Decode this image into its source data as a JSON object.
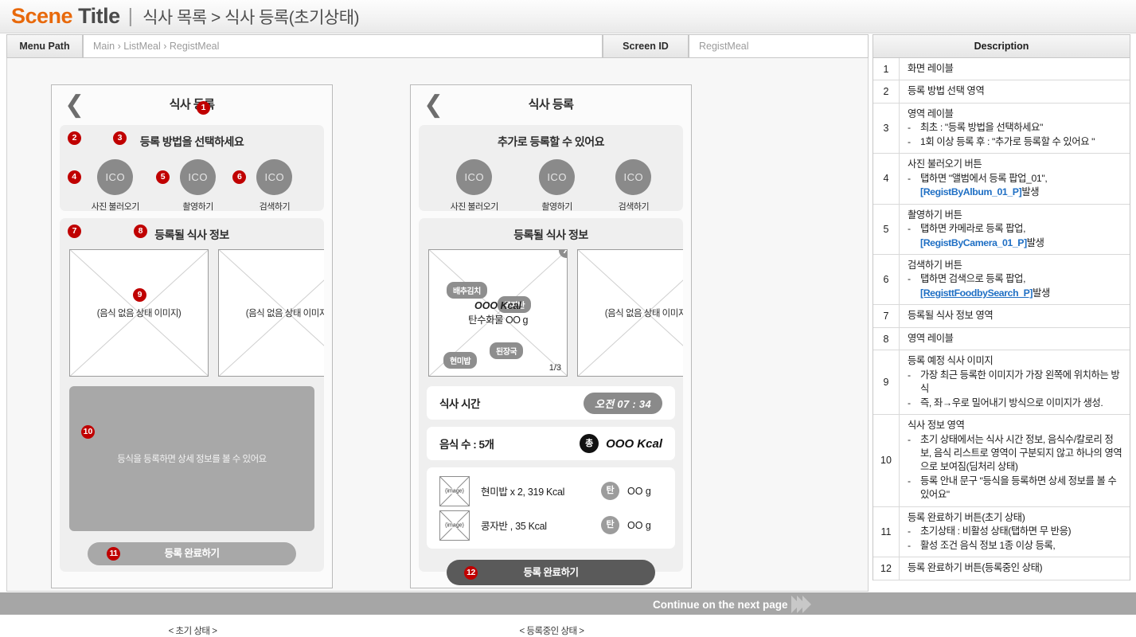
{
  "header": {
    "scene_word": "Scene",
    "title_word": "Title",
    "divider": "|",
    "breadcrumb": "식사 목록 > 식사 등록(초기상태)"
  },
  "meta": {
    "menu_path_label": "Menu Path",
    "menu_path_value": "Main › ListMeal › RegistMeal",
    "screen_id_label": "Screen ID",
    "screen_id_value": "RegistMeal",
    "description_label": "Description"
  },
  "mockup_initial": {
    "caption": "< 초기 상태 >",
    "back_icon": "❮",
    "title": "식사 등록",
    "method_section_title": "등록  방법을 선택하세요",
    "methods": [
      {
        "icon_text": "ICO",
        "label": "사진 불러오기"
      },
      {
        "icon_text": "ICO",
        "label": "촬영하기"
      },
      {
        "icon_text": "ICO",
        "label": "검색하기"
      }
    ],
    "meal_section_title": "등록될 식사 정보",
    "image_placeholder_caption": "(음식 없음 상태 이미지)",
    "dim_message": "등식을 등록하면 상세 정보를 볼 수 있어요",
    "cta_label": "등록 완료하기",
    "markers": [
      "1",
      "2",
      "3",
      "4",
      "5",
      "6",
      "7",
      "8",
      "9",
      "10",
      "11"
    ]
  },
  "mockup_registering": {
    "caption": "< 등록중인 상태 >",
    "back_icon": "❮",
    "title": "식사 등록",
    "method_section_title": "추가로 등록할 수 있어요",
    "methods": [
      {
        "icon_text": "ICO",
        "label": "사진 불러오기"
      },
      {
        "icon_text": "ICO",
        "label": "촬영하기"
      },
      {
        "icon_text": "ICO",
        "label": "검색하기"
      }
    ],
    "meal_section_title": "등록될 식사 정보",
    "photo": {
      "close_icon": "X",
      "chips": [
        "배추김치",
        "콩자반",
        "된장국",
        "현미밥"
      ],
      "kcal_line": "OOO Kcal",
      "carb_line": "탄수화물 OO g",
      "page_index": "1/3"
    },
    "image_placeholder_caption": "(음식 없음 상태 이미지)",
    "meal_time_label": "식사 시간",
    "meal_time_value": "오전 07 : 34",
    "food_count_label": "음식 수 : 5개",
    "total_badge": "총",
    "total_kcal": "OOO Kcal",
    "food_items": [
      {
        "thumb_label": "(image)",
        "name": "현미밥 x 2, 319 Kcal",
        "nutrient_badge": "탄",
        "nutrient_value": "OO g"
      },
      {
        "thumb_label": "(image)",
        "name": "콩자반 , 35 Kcal",
        "nutrient_badge": "탄",
        "nutrient_value": "OO g"
      }
    ],
    "cta_label": "등록 완료하기",
    "markers": [
      "12"
    ]
  },
  "footer": {
    "continue_text": "Continue on the next page"
  },
  "descriptions": [
    {
      "no": "1",
      "head": "화면 레이블",
      "bullets": []
    },
    {
      "no": "2",
      "head": "등록 방법 선택 영역",
      "bullets": []
    },
    {
      "no": "3",
      "head": "영역 레이블",
      "bullets": [
        "최초 : \"등록 방법을 선택하세요\"",
        "1회 이상 등록 후 : \"추가로 등록할 수 있어요 \""
      ]
    },
    {
      "no": "4",
      "head": "사진 불러오기 버튼",
      "bullets": [
        "탭하면 \"앨범에서 등록 팝업_01\","
      ],
      "link": "[RegistByAlbum_01_P]",
      "link_tail": "발생"
    },
    {
      "no": "5",
      "head": "촬영하기 버튼",
      "bullets": [
        "탭하면 카메라로 등록 팝업,"
      ],
      "link": "[RegistByCamera_01_P]",
      "link_tail": " 발생"
    },
    {
      "no": "6",
      "head": "검색하기 버튼",
      "bullets": [
        "탭하면 검색으로 등록 팝업,"
      ],
      "link": "[RegisttFoodbySearch_P]",
      "link_tail": " 발생",
      "link_underline": true
    },
    {
      "no": "7",
      "head": "등록될 식사 정보 영역",
      "bullets": []
    },
    {
      "no": "8",
      "head": "영역 레이블",
      "bullets": []
    },
    {
      "no": "9",
      "head": "등록 예정 식사 이미지",
      "bullets": [
        "가장 최근 등록한 이미지가 가장 왼쪽에 위치하는 방식",
        "즉, 좌→우로 밀어내기 방식으로 이미지가 생성."
      ]
    },
    {
      "no": "10",
      "head": "식사 정보 영역",
      "bullets": [
        "초기 상태에서는 식사 시간 정보, 음식수/칼로리 정보, 음식 리스트로 영역이 구분되지 않고 하나의 영역으로 보여짐(딤처리 상태)",
        "등록 안내 문구 \"등식을 등록하면 상세 정보를 볼 수 있어요\""
      ]
    },
    {
      "no": "11",
      "head": "등록 완료하기 버튼(초기 상태)",
      "bullets": [
        "초기상태 : 비활성 상태(탭하면 무 반응)",
        "활성 조건 음식 정보 1종 이상 등록,"
      ]
    },
    {
      "no": "12",
      "head": "등록 완료하기 버튼(등록중인 상태)",
      "bullets": []
    }
  ]
}
